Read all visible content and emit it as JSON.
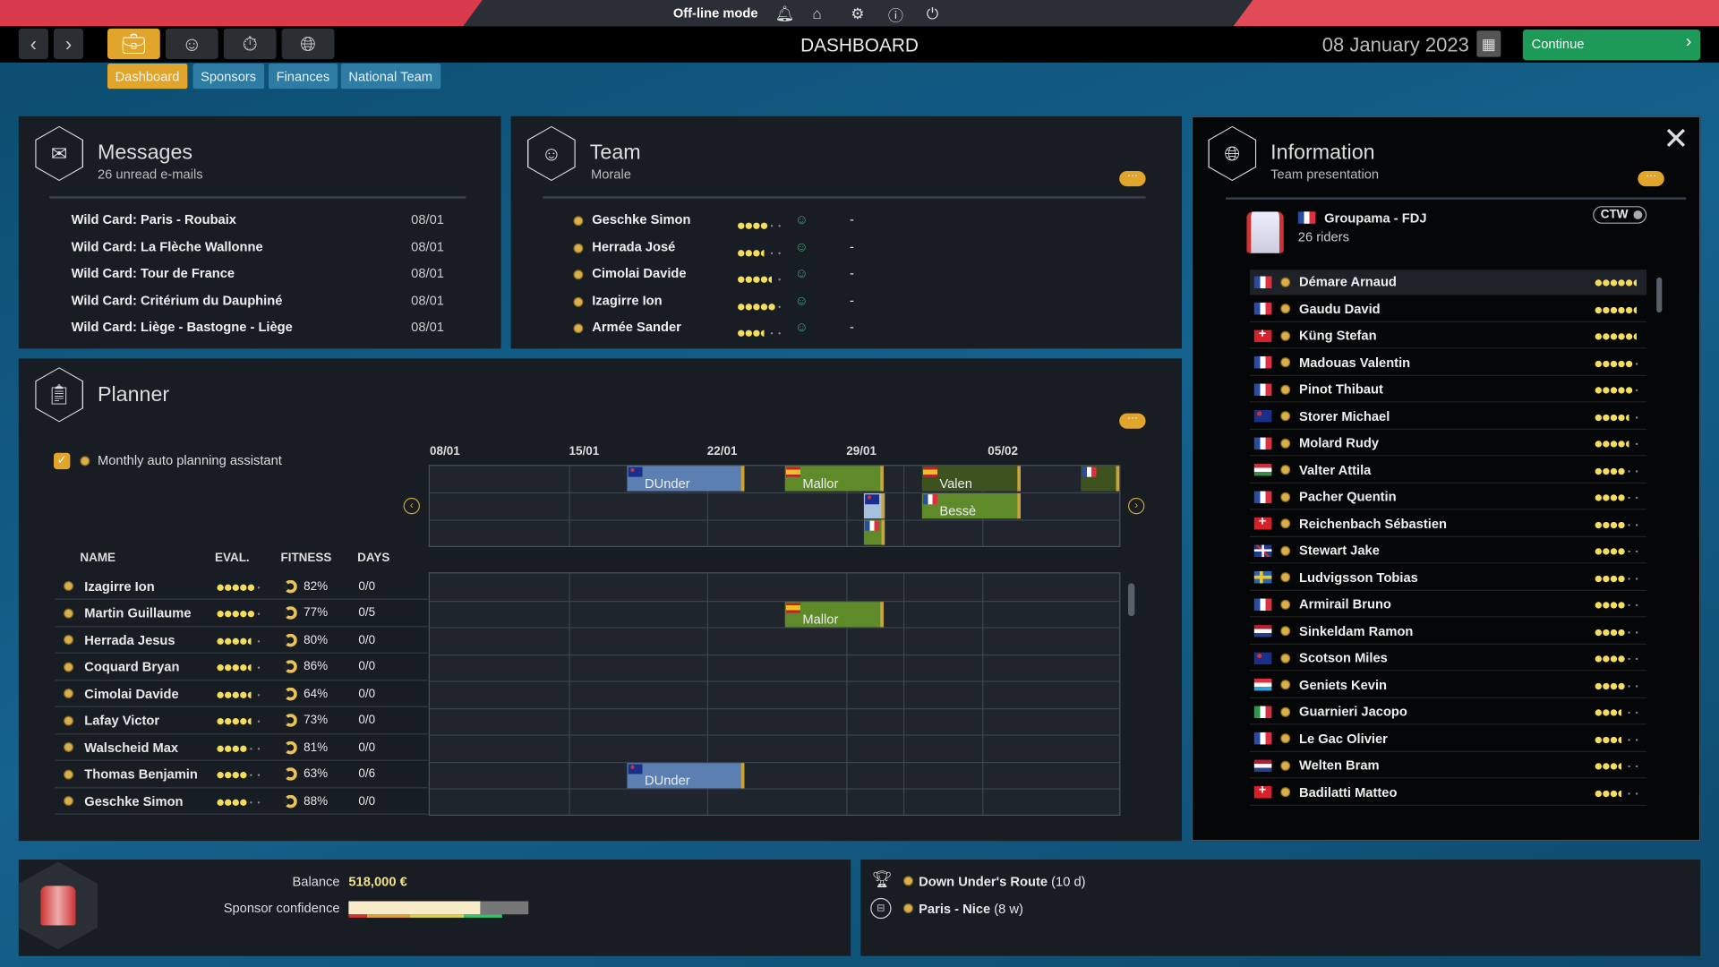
{
  "topbar": {
    "mode": "Off-line mode",
    "icons": [
      "bell-icon",
      "home-icon",
      "gear-icon",
      "info-icon",
      "power-icon"
    ]
  },
  "nav": {
    "icons": [
      "briefcase-icon",
      "team-icon",
      "stopwatch-icon",
      "globe-icon"
    ],
    "title": "DASHBOARD",
    "date": "08 January 2023",
    "continue": "Continue"
  },
  "tabs": [
    "Dashboard",
    "Sponsors",
    "Finances",
    "National Team"
  ],
  "messages": {
    "title": "Messages",
    "subtitle": "26 unread e-mails",
    "items": [
      {
        "text": "Wild Card: Paris - Roubaix",
        "date": "08/01"
      },
      {
        "text": "Wild Card: La Flèche Wallonne",
        "date": "08/01"
      },
      {
        "text": "Wild Card: Tour de France",
        "date": "08/01"
      },
      {
        "text": "Wild Card: Critérium du Dauphiné",
        "date": "08/01"
      },
      {
        "text": "Wild Card: Liège - Bastogne - Liège",
        "date": "08/01"
      }
    ]
  },
  "team": {
    "title": "Team",
    "subtitle": "Morale",
    "more": "···",
    "riders": [
      {
        "name": "Geschke Simon",
        "rating": 4,
        "morale": "-"
      },
      {
        "name": "Herrada José",
        "rating": 3.5,
        "morale": "-"
      },
      {
        "name": "Cimolai Davide",
        "rating": 4.5,
        "morale": "-"
      },
      {
        "name": "Izagirre Ion",
        "rating": 5,
        "morale": "-"
      },
      {
        "name": "Armée Sander",
        "rating": 3.5,
        "morale": "-"
      }
    ]
  },
  "planner": {
    "title": "Planner",
    "more": "···",
    "auto_label": "Monthly auto planning assistant",
    "auto_checked": true,
    "weeks": [
      "08/01",
      "15/01",
      "22/01",
      "29/01",
      "05/02"
    ],
    "columns": [
      "NAME",
      "EVAL.",
      "FITNESS",
      "DAYS"
    ],
    "events": [
      {
        "label": "DUnder",
        "flag": "au"
      },
      {
        "label": "Mallor",
        "flag": "es"
      },
      {
        "label": "",
        "flag": "au"
      },
      {
        "label": "",
        "flag": "fr"
      },
      {
        "label": "Valen",
        "flag": "es"
      },
      {
        "label": "Bessè",
        "flag": "fr"
      },
      {
        "label": "",
        "flag": "fr"
      }
    ],
    "riders": [
      {
        "name": "Izagirre Ion",
        "rating": 5,
        "fitness": "82%",
        "days": "0/0"
      },
      {
        "name": "Martin Guillaume",
        "rating": 5,
        "fitness": "77%",
        "days": "0/5",
        "event": {
          "label": "Mallor",
          "flag": "es"
        }
      },
      {
        "name": "Herrada Jesus",
        "rating": 4.5,
        "fitness": "80%",
        "days": "0/0"
      },
      {
        "name": "Coquard Bryan",
        "rating": 4.5,
        "fitness": "86%",
        "days": "0/0"
      },
      {
        "name": "Cimolai Davide",
        "rating": 4.5,
        "fitness": "64%",
        "days": "0/0"
      },
      {
        "name": "Lafay Victor",
        "rating": 4.5,
        "fitness": "73%",
        "days": "0/0"
      },
      {
        "name": "Walscheid Max",
        "rating": 4,
        "fitness": "81%",
        "days": "0/0"
      },
      {
        "name": "Thomas Benjamin",
        "rating": 4,
        "fitness": "63%",
        "days": "0/6",
        "event": {
          "label": "DUnder",
          "flag": "au"
        }
      },
      {
        "name": "Geschke Simon",
        "rating": 4,
        "fitness": "88%",
        "days": "0/0"
      }
    ]
  },
  "information": {
    "title": "Information",
    "subtitle": "Team presentation",
    "more": "···",
    "team_name": "Groupama - FDJ",
    "team_flag": "fr",
    "riders_count": "26 riders",
    "badge": "CTW",
    "riders": [
      {
        "name": "Démare Arnaud",
        "flag": "fr",
        "rating": 5.5
      },
      {
        "name": "Gaudu David",
        "flag": "fr",
        "rating": 5.5
      },
      {
        "name": "Küng Stefan",
        "flag": "ch",
        "rating": 5.5
      },
      {
        "name": "Madouas Valentin",
        "flag": "fr",
        "rating": 5
      },
      {
        "name": "Pinot Thibaut",
        "flag": "fr",
        "rating": 5
      },
      {
        "name": "Storer Michael",
        "flag": "au",
        "rating": 4.5
      },
      {
        "name": "Molard Rudy",
        "flag": "fr",
        "rating": 4.5
      },
      {
        "name": "Valter Attila",
        "flag": "hu",
        "rating": 4
      },
      {
        "name": "Pacher Quentin",
        "flag": "fr",
        "rating": 4
      },
      {
        "name": "Reichenbach Sébastien",
        "flag": "ch",
        "rating": 4
      },
      {
        "name": "Stewart Jake",
        "flag": "gb",
        "rating": 4
      },
      {
        "name": "Ludvigsson Tobias",
        "flag": "se",
        "rating": 4
      },
      {
        "name": "Armirail Bruno",
        "flag": "fr",
        "rating": 4
      },
      {
        "name": "Sinkeldam Ramon",
        "flag": "nl",
        "rating": 4
      },
      {
        "name": "Scotson Miles",
        "flag": "au",
        "rating": 4
      },
      {
        "name": "Geniets Kevin",
        "flag": "lu",
        "rating": 4
      },
      {
        "name": "Guarnieri Jacopo",
        "flag": "it",
        "rating": 3.5
      },
      {
        "name": "Le Gac Olivier",
        "flag": "fr",
        "rating": 3.5
      },
      {
        "name": "Welten Bram",
        "flag": "nl",
        "rating": 3.5
      },
      {
        "name": "Badilatti Matteo",
        "flag": "ch",
        "rating": 3.5
      }
    ]
  },
  "finance": {
    "balance_label": "Balance",
    "balance": "518,000 €",
    "confidence_label": "Sponsor confidence",
    "confidence": 0.73
  },
  "races": [
    {
      "name": "Down Under's Route",
      "detail": "(10 d)",
      "icon": "trophy-icon"
    },
    {
      "name": "Paris - Nice",
      "detail": "(8 w)",
      "icon": "stage-race-icon"
    }
  ],
  "colors": {
    "accent": "#e0a52a",
    "continue": "#1e9a58",
    "panel": "#181d24",
    "event_blue": "#5a7fb0",
    "event_green": "#5e8a2a"
  }
}
